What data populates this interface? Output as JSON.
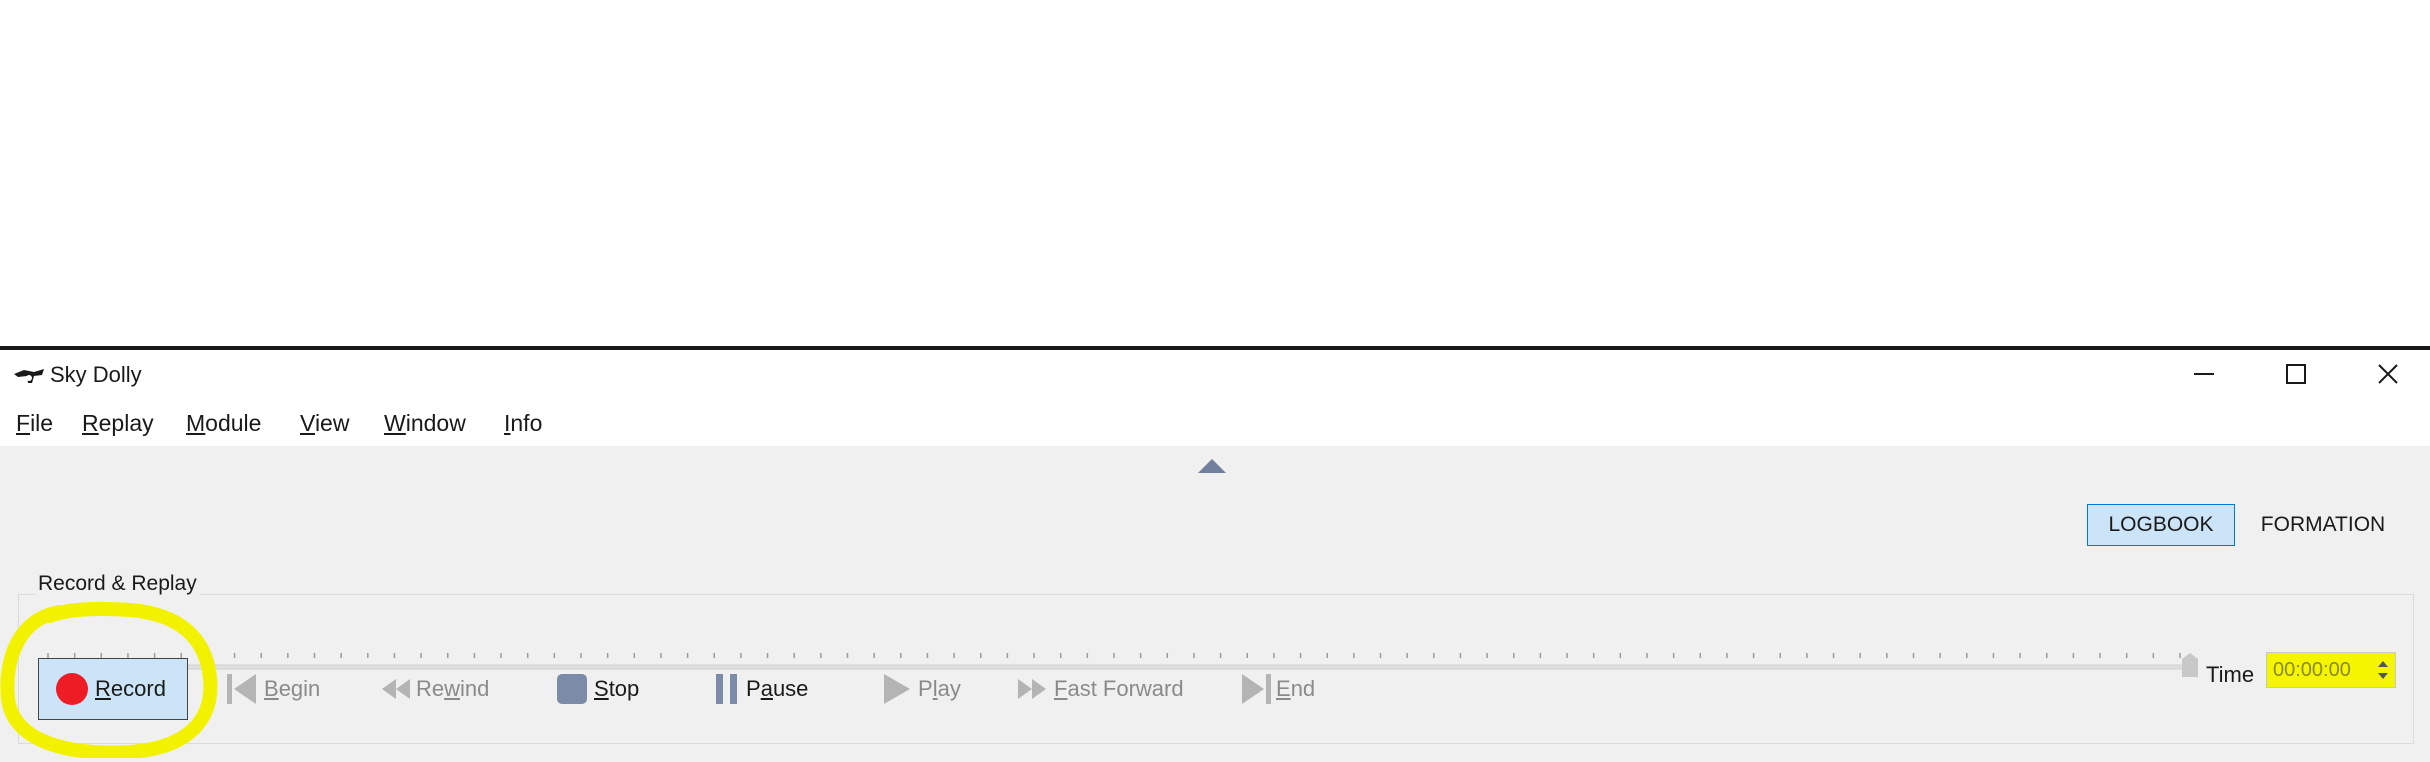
{
  "window": {
    "title": "Sky Dolly",
    "controls": [
      "minimize-icon",
      "maximize-icon",
      "close-icon"
    ]
  },
  "menu": [
    {
      "label": "File",
      "accel_index": 0
    },
    {
      "label": "Replay",
      "accel_index": 0
    },
    {
      "label": "Module",
      "accel_index": 0
    },
    {
      "label": "View",
      "accel_index": 0
    },
    {
      "label": "Window",
      "accel_index": 0
    },
    {
      "label": "Info",
      "accel_index": 0
    }
  ],
  "tabs": {
    "logbook": "LOGBOOK",
    "formation": "FORMATION",
    "active": "LOGBOOK"
  },
  "record_replay": {
    "group_title": "Record & Replay",
    "time_label": "Time",
    "time_value": "00:00:00",
    "slider_position": 1.0
  },
  "controls": [
    {
      "key": "record",
      "label": "Record",
      "icon": "record-icon",
      "enabled": true
    },
    {
      "key": "begin",
      "label": "Begin",
      "icon": "skip-back-icon",
      "enabled": false
    },
    {
      "key": "rewind",
      "label": "Rewind",
      "icon": "rewind-icon",
      "enabled": false
    },
    {
      "key": "stop",
      "label": "Stop",
      "icon": "stop-icon",
      "enabled": true
    },
    {
      "key": "pause",
      "label": "Pause",
      "icon": "pause-icon",
      "enabled": true
    },
    {
      "key": "play",
      "label": "Play",
      "icon": "play-icon",
      "enabled": false
    },
    {
      "key": "fast_forward",
      "label": "Fast Forward",
      "icon": "fast-forward-icon",
      "enabled": false
    },
    {
      "key": "end",
      "label": "End",
      "icon": "skip-end-icon",
      "enabled": false
    }
  ],
  "colors": {
    "accent": "#cce4f7",
    "accent_border": "#0078d7",
    "record": "#ee1c25",
    "highlight": "#f5f500",
    "icon_enabled": "#7b8ba8",
    "icon_disabled": "#b4b4b4"
  }
}
